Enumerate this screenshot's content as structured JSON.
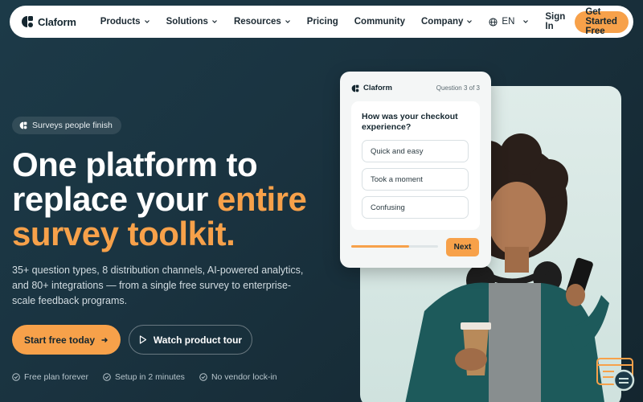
{
  "brand": {
    "name": "Claform"
  },
  "nav": {
    "items": [
      {
        "label": "Products",
        "has_dropdown": true
      },
      {
        "label": "Solutions",
        "has_dropdown": true
      },
      {
        "label": "Resources",
        "has_dropdown": true
      },
      {
        "label": "Pricing",
        "has_dropdown": false
      },
      {
        "label": "Community",
        "has_dropdown": false
      },
      {
        "label": "Company",
        "has_dropdown": true
      }
    ],
    "language": "EN",
    "signin_label": "Sign In",
    "cta_label": "Get Started Free"
  },
  "hero": {
    "badge": "Surveys people finish",
    "headline_line1": "One platform to",
    "headline_line2a": "replace your ",
    "headline_line2b": "entire",
    "headline_line3": "survey toolkit.",
    "subtext": "35+ question types, 8 distribution channels, AI-powered analytics, and 80+ integrations — from a single free survey to enterprise-scale feedback programs.",
    "primary_cta": "Start free today",
    "secondary_cta": "Watch product tour",
    "perks": [
      "Free plan forever",
      "Setup in 2 minutes",
      "No vendor lock-in"
    ]
  },
  "survey_card": {
    "brand": "Claform",
    "question_counter": "Question 3 of 3",
    "question": "How was your checkout experience?",
    "options": [
      "Quick and easy",
      "Took a moment",
      "Confusing"
    ],
    "progress": 0.67,
    "next_label": "Next"
  },
  "colors": {
    "accent": "#f7a14a",
    "background": "#1a3340",
    "text_dark": "#14262f"
  }
}
